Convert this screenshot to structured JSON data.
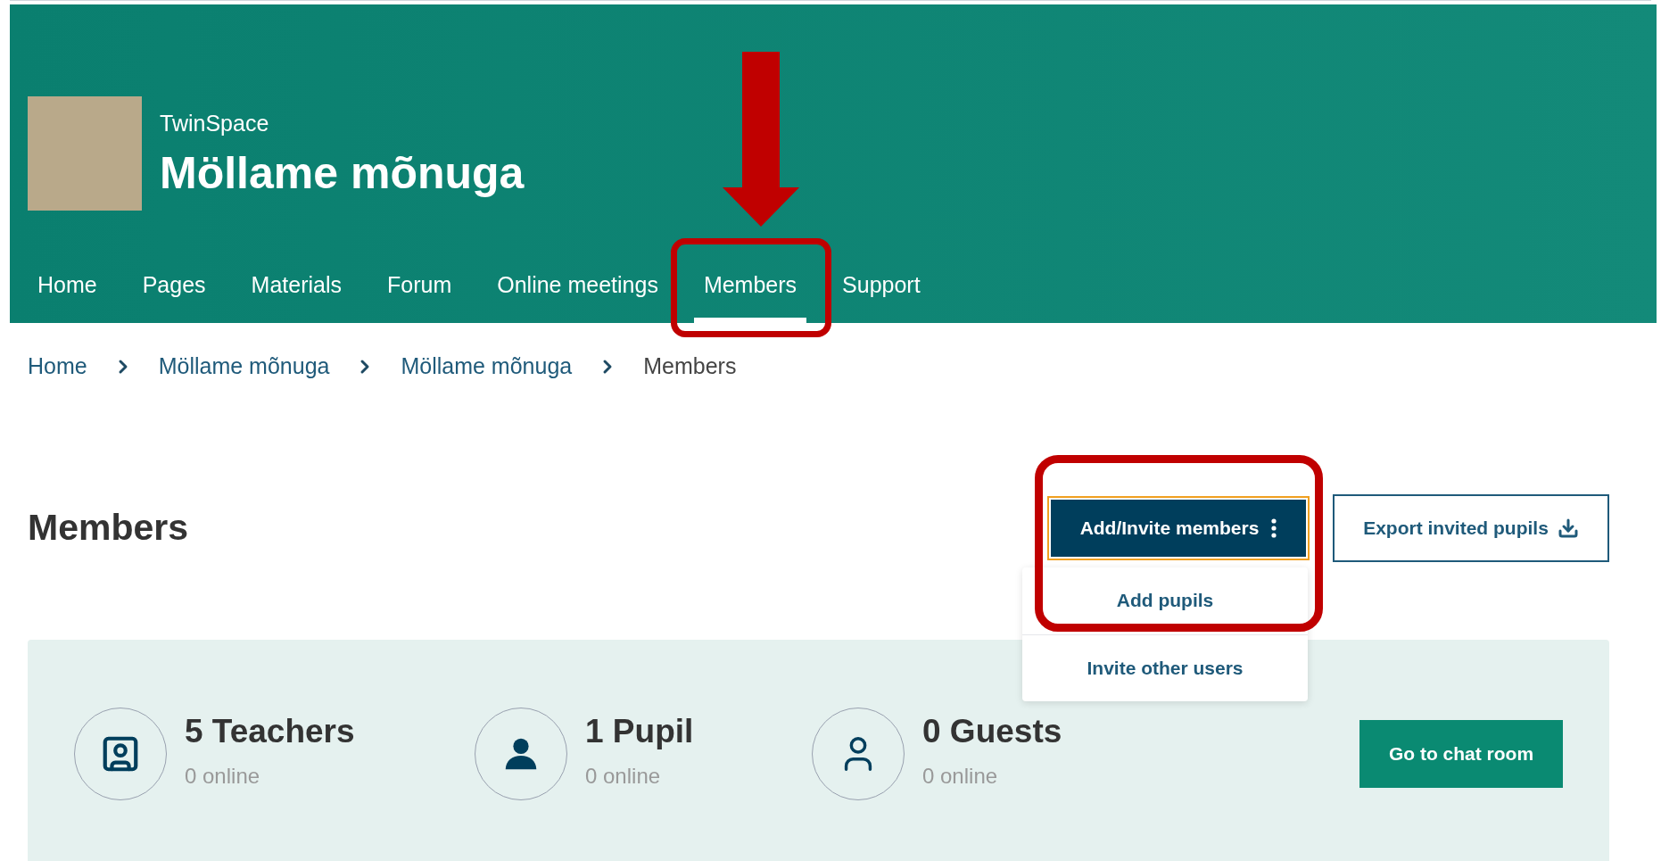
{
  "header": {
    "site": "TwinSpace",
    "title": "Möllame mõnuga"
  },
  "nav": [
    {
      "label": "Home",
      "selected": false
    },
    {
      "label": "Pages",
      "selected": false
    },
    {
      "label": "Materials",
      "selected": false
    },
    {
      "label": "Forum",
      "selected": false
    },
    {
      "label": "Online meetings",
      "selected": false
    },
    {
      "label": "Members",
      "selected": true
    },
    {
      "label": "Support",
      "selected": false
    }
  ],
  "breadcrumb": [
    {
      "label": "Home",
      "current": false
    },
    {
      "label": "Möllame mõnuga",
      "current": false
    },
    {
      "label": "Möllame mõnuga",
      "current": false
    },
    {
      "label": "Members",
      "current": true
    }
  ],
  "page_title": "Members",
  "add_button": {
    "label": "Add/Invite members",
    "expanded": true
  },
  "menu": [
    "Add pupils",
    "Invite other users"
  ],
  "export_button": "Export invited pupils",
  "stats": [
    {
      "kind": "teacher",
      "count": "5 Teachers",
      "online": "0 online"
    },
    {
      "kind": "pupil",
      "count": "1 Pupil",
      "online": "0 online"
    },
    {
      "kind": "guest",
      "count": "0 Guests",
      "online": "0 online"
    }
  ],
  "chat_button": "Go to chat room"
}
